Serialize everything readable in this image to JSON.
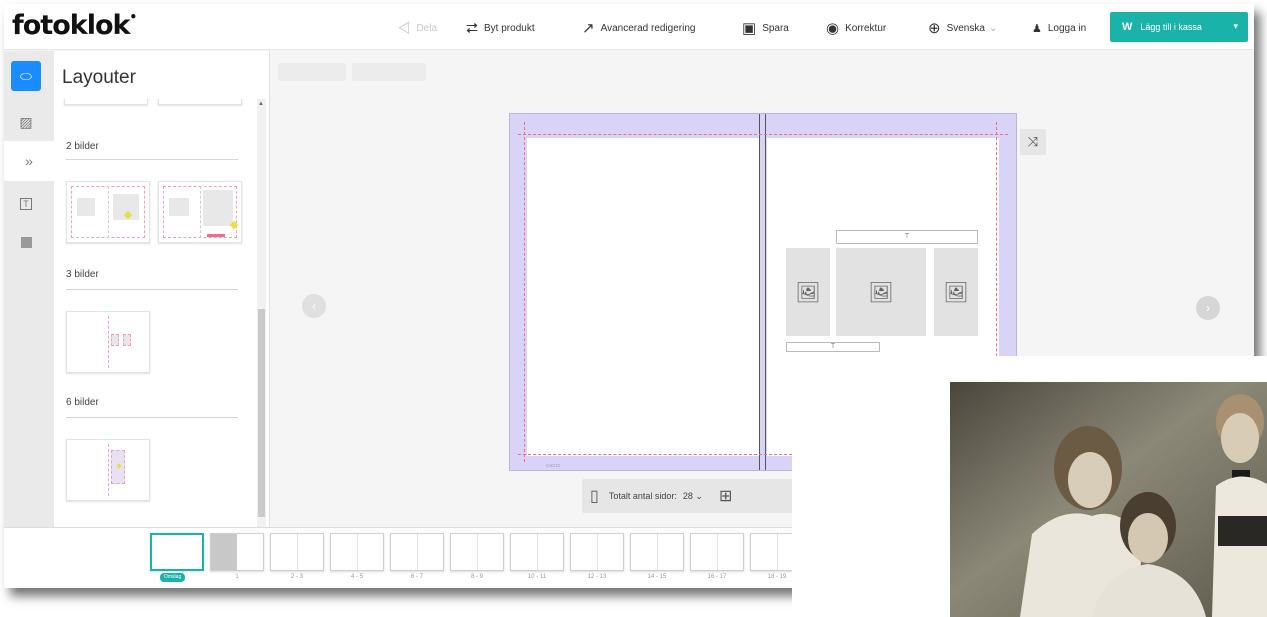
{
  "brand": {
    "logo": "fotoklok"
  },
  "toolbar": {
    "share": "Dela",
    "change_product": "Byt produkt",
    "advanced_edit": "Avancerad redigering",
    "save": "Spara",
    "proof": "Korrektur",
    "language": "Svenska",
    "login": "Logga in",
    "cart": "Lägg till i kassa"
  },
  "panel": {
    "title": "Layouter",
    "sections": [
      {
        "label": "2 bilder"
      },
      {
        "label": "3 bilder"
      },
      {
        "label": "6 bilder"
      }
    ]
  },
  "editor": {
    "text_placeholder": "T",
    "page_count_label": "Totalt antal sidor:",
    "page_count_value": "28"
  },
  "filmstrip": {
    "cover_label": "Omslag",
    "labels": [
      "1",
      "2 - 3",
      "4 - 5",
      "6 - 7",
      "8 - 9",
      "10 - 11",
      "12 - 13",
      "14 - 15",
      "16 - 17",
      "18 - 19"
    ]
  },
  "colors": {
    "accent": "#1ab3aa",
    "active_tool": "#1a8cff",
    "bleed": "#f26b8a",
    "spread_margin": "#d9d4f7"
  },
  "icons": [
    "share-icon",
    "swap-product-icon",
    "external-edit-icon",
    "save-icon",
    "eye-icon",
    "globe-icon",
    "user-icon",
    "layout-icon",
    "image-icon",
    "double-chevron-icon",
    "text-icon",
    "background-icon",
    "shuffle-icon",
    "arrow-left-icon",
    "arrow-right-icon",
    "add-photo-icon"
  ]
}
